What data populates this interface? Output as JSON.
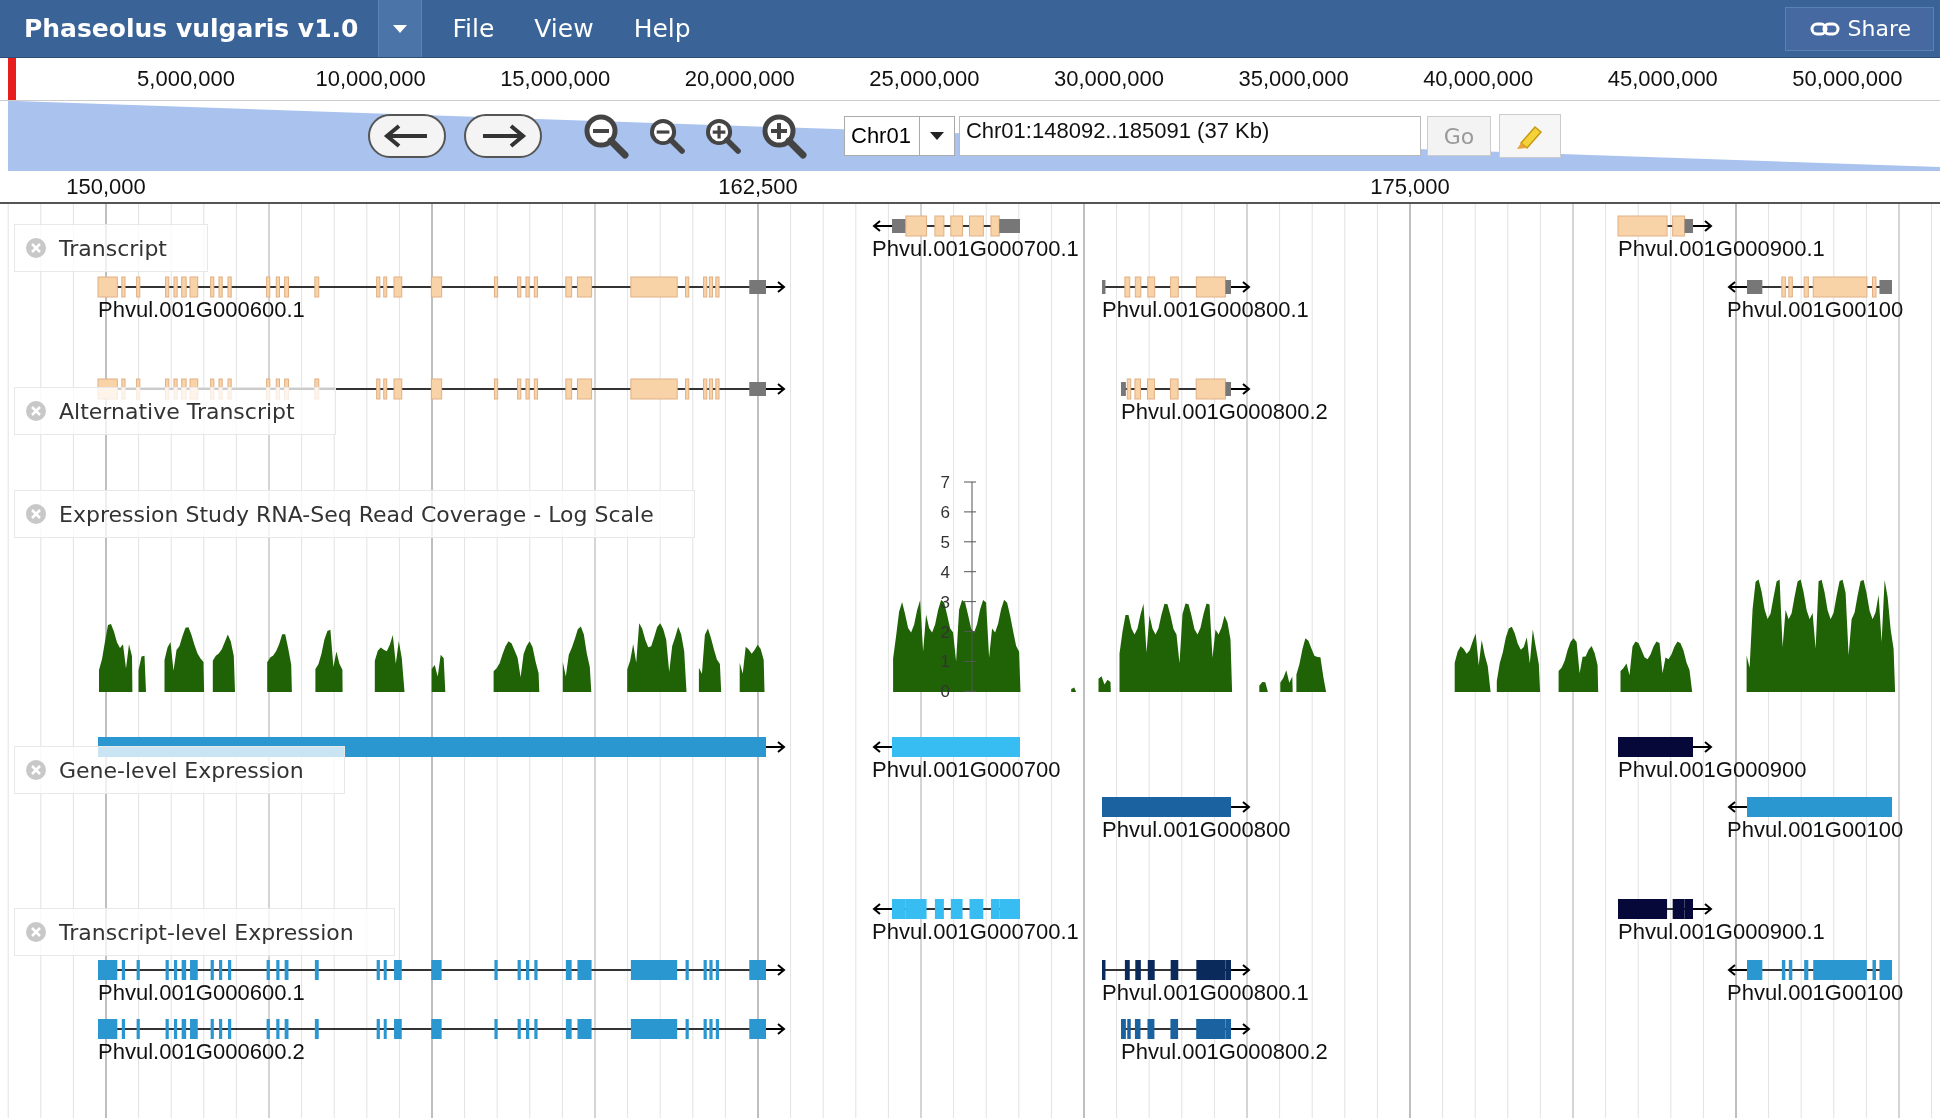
{
  "app": {
    "title": "Phaseolus vulgaris v1.0",
    "menus": [
      "File",
      "View",
      "Help"
    ],
    "share": "Share"
  },
  "overview": {
    "ticks": [
      "5,000,000",
      "10,000,000",
      "15,000,000",
      "20,000,000",
      "25,000,000",
      "30,000,000",
      "35,000,000",
      "40,000,000",
      "45,000,000",
      "50,000,000"
    ]
  },
  "nav": {
    "chromosome": "Chr01",
    "location": "Chr01:148092..185091 (37 Kb)",
    "go": "Go"
  },
  "ruler": {
    "ticks": [
      "150,000",
      "162,500",
      "175,000"
    ]
  },
  "tracks": [
    {
      "label": "Transcript",
      "kind": "transcripts",
      "features": [
        {
          "name": "Phvul.001G000700.1",
          "reverse": true
        },
        {
          "name": "Phvul.001G000900.1",
          "reverse": false
        },
        {
          "name": "Phvul.001G000600.1",
          "reverse": false
        },
        {
          "name": "Phvul.001G000800.1",
          "reverse": false
        },
        {
          "name": "Phvul.001G00100",
          "reverse": true
        }
      ]
    },
    {
      "label": "Alternative Transcript",
      "kind": "transcripts",
      "features": [
        {
          "reverse": false
        },
        {
          "name": "Phvul.001G000800.2",
          "reverse": false
        }
      ]
    },
    {
      "label": "Expression Study RNA-Seq Read Coverage - Log Scale",
      "kind": "coverage",
      "axis_ticks": [
        "7",
        "6",
        "5",
        "4",
        "3",
        "2",
        "1",
        "0"
      ]
    },
    {
      "label": "Gene-level Expression",
      "kind": "genes",
      "features": [
        {
          "color": "#2b97d1",
          "reverse": false
        },
        {
          "name": "Phvul.001G000700",
          "color": "#38bdf2",
          "reverse": true
        },
        {
          "name": "Phvul.001G000900",
          "color": "#050838",
          "reverse": false
        },
        {
          "name": "Phvul.001G000800",
          "color": "#1b63a0",
          "reverse": false
        },
        {
          "name": "Phvul.001G00100",
          "color": "#2b97d1",
          "reverse": true
        }
      ]
    },
    {
      "label": "Transcript-level Expression",
      "kind": "transcripts",
      "features": [
        {
          "name": "Phvul.001G000700.1",
          "color": "#38bdf2",
          "reverse": true
        },
        {
          "name": "Phvul.001G000900.1",
          "color": "#050838",
          "reverse": false
        },
        {
          "name": "Phvul.001G000600.1",
          "color": "#2b97d1",
          "reverse": false
        },
        {
          "name": "Phvul.001G000800.1",
          "color": "#0a2a5c",
          "reverse": false
        },
        {
          "name": "Phvul.001G00100",
          "color": "#2b97d1",
          "reverse": true
        },
        {
          "name": "Phvul.001G000600.2",
          "color": "#2b97d1",
          "reverse": false
        },
        {
          "name": "Phvul.001G000800.2",
          "color": "#1b63a0",
          "reverse": false
        }
      ]
    }
  ]
}
